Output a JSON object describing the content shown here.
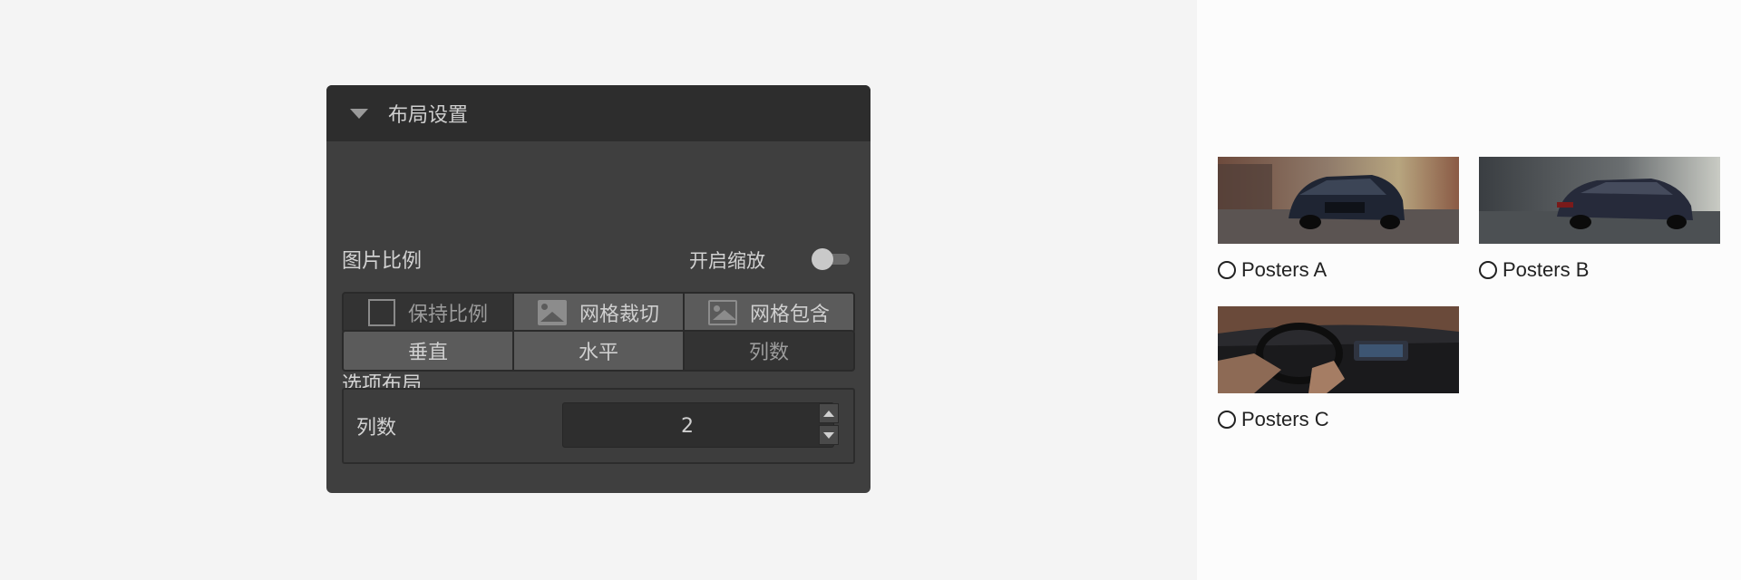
{
  "panel": {
    "title": "布局设置",
    "image_ratio": {
      "label": "图片比例",
      "zoom_label": "开启缩放",
      "zoom_enabled": false,
      "options": [
        {
          "label": "保持比例",
          "icon": "square-icon",
          "selected": false
        },
        {
          "label": "网格裁切",
          "icon": "image-icon",
          "selected": true
        },
        {
          "label": "网格包含",
          "icon": "image-outline-icon",
          "selected": true
        }
      ]
    },
    "option_layout": {
      "label": "选项布局",
      "options": [
        {
          "label": "垂直",
          "selected": true
        },
        {
          "label": "水平",
          "selected": true
        },
        {
          "label": "列数",
          "selected": false
        }
      ]
    },
    "columns": {
      "label": "列数",
      "value": "2"
    }
  },
  "posters": [
    {
      "label": "Posters A",
      "image": "car-front-view",
      "selected": false
    },
    {
      "label": "Posters B",
      "image": "car-rear-view",
      "selected": false
    },
    {
      "label": "Posters C",
      "image": "car-interior",
      "selected": false
    }
  ]
}
